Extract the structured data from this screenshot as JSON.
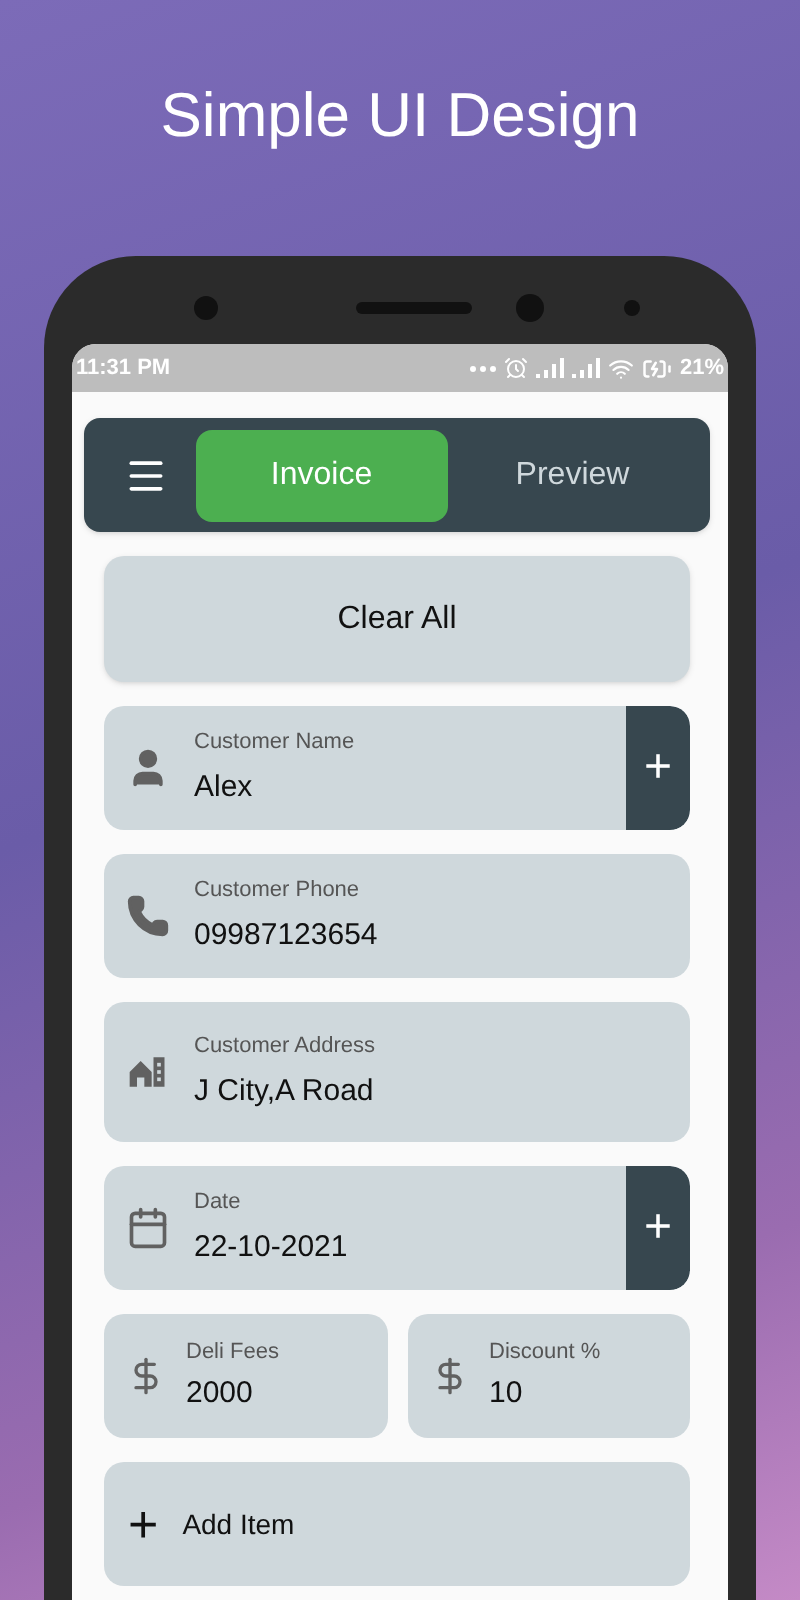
{
  "headline": "Simple UI Design",
  "status_bar": {
    "time": "11:31 PM",
    "battery": "21%"
  },
  "app_bar": {
    "tabs": [
      {
        "label": "Invoice",
        "selected": true
      },
      {
        "label": "Preview",
        "selected": false
      }
    ]
  },
  "clear_button": "Clear All",
  "fields": [
    {
      "label": "Customer Name",
      "value": "Alex",
      "add_button": "+"
    },
    {
      "label": "Customer Phone",
      "value": "09987123654"
    },
    {
      "label": "Customer Address",
      "value": "J City,A Road"
    },
    {
      "label": "Date",
      "value": "22-10-2021",
      "add_button": "+"
    }
  ],
  "amount_fields": [
    {
      "label": "Deli Fees",
      "value": "2000"
    },
    {
      "label": "Discount %",
      "value": "10"
    }
  ],
  "add_item": {
    "icon": "+",
    "label": "Add Item"
  }
}
